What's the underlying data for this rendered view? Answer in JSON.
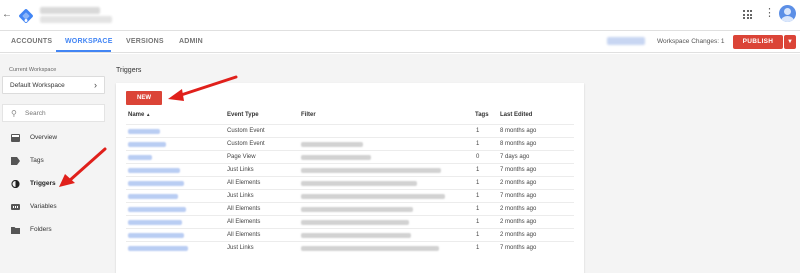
{
  "header": {
    "back_icon": "arrow-back-icon",
    "logo_icon": "gtm-logo-icon",
    "apps_icon": "apps-grid-icon",
    "more_icon": "more-vert-icon",
    "avatar_icon": "account-avatar-icon"
  },
  "tabs": [
    {
      "label": "ACCOUNTS",
      "active": false
    },
    {
      "label": "WORKSPACE",
      "active": true
    },
    {
      "label": "VERSIONS",
      "active": false
    },
    {
      "label": "ADMIN",
      "active": false
    }
  ],
  "toolbar": {
    "workspace_changes": "Workspace Changes: 1",
    "publish_label": "PUBLISH",
    "publish_dropdown_icon": "chevron-down-icon"
  },
  "sidebar": {
    "current_workspace_label": "Current Workspace",
    "workspace_name": "Default Workspace",
    "search_placeholder": "Search",
    "items": [
      {
        "label": "Overview",
        "icon": "overview-icon",
        "active": false
      },
      {
        "label": "Tags",
        "icon": "tag-icon",
        "active": false
      },
      {
        "label": "Triggers",
        "icon": "trigger-icon",
        "active": true
      },
      {
        "label": "Variables",
        "icon": "variables-icon",
        "active": false
      },
      {
        "label": "Folders",
        "icon": "folder-icon",
        "active": false
      }
    ]
  },
  "main": {
    "title": "Triggers",
    "new_label": "NEW",
    "columns": {
      "name": "Name",
      "sort_icon": "▲",
      "event_type": "Event Type",
      "filter": "Filter",
      "tags": "Tags",
      "last_edited": "Last Edited"
    },
    "rows": [
      {
        "event_type": "Custom Event",
        "tags": "1",
        "last_edited": "8 months ago"
      },
      {
        "event_type": "Custom Event",
        "tags": "1",
        "last_edited": "8 months ago"
      },
      {
        "event_type": "Page View",
        "tags": "0",
        "last_edited": "7 days ago"
      },
      {
        "event_type": "Just Links",
        "tags": "1",
        "last_edited": "7 months ago"
      },
      {
        "event_type": "All Elements",
        "tags": "1",
        "last_edited": "2 months ago"
      },
      {
        "event_type": "Just Links",
        "tags": "1",
        "last_edited": "7 months ago"
      },
      {
        "event_type": "All Elements",
        "tags": "1",
        "last_edited": "2 months ago"
      },
      {
        "event_type": "All Elements",
        "tags": "1",
        "last_edited": "2 months ago"
      },
      {
        "event_type": "All Elements",
        "tags": "1",
        "last_edited": "2 months ago"
      },
      {
        "event_type": "Just Links",
        "tags": "1",
        "last_edited": "7 months ago"
      }
    ]
  },
  "colors": {
    "accent": "#4285f4",
    "publish": "#db4437",
    "annotation_arrow": "#e0201b"
  }
}
